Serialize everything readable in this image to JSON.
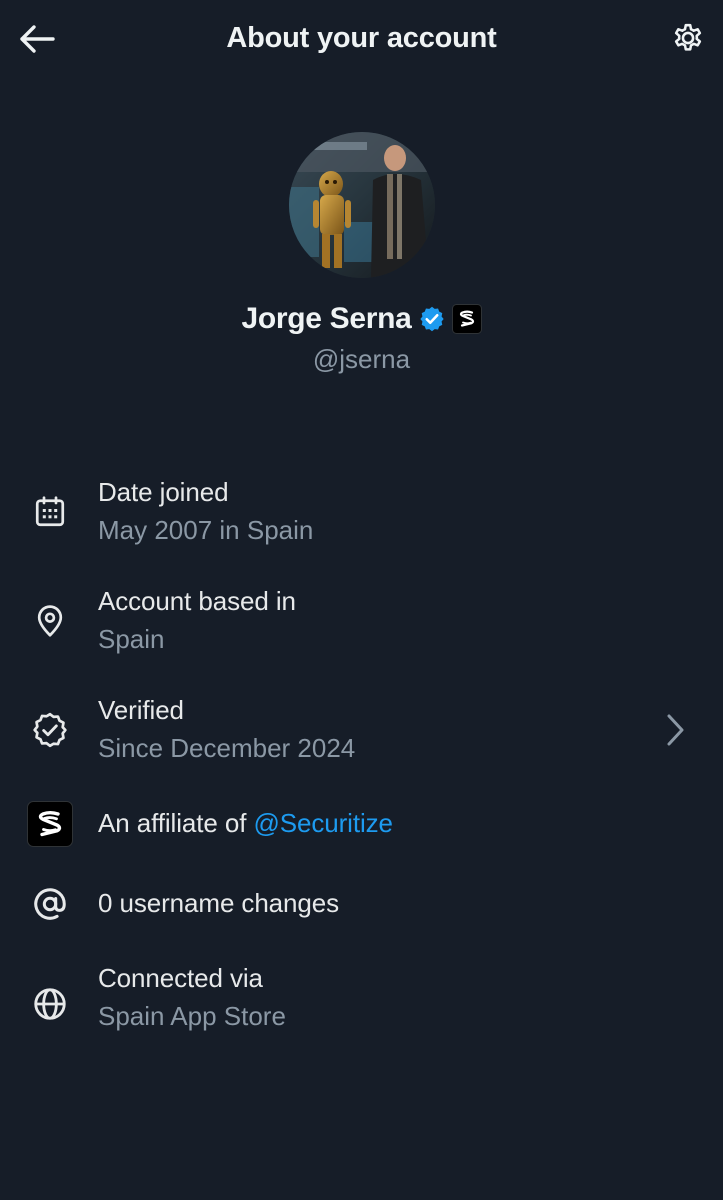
{
  "header": {
    "title": "About your account",
    "back_icon": "arrow-left-icon",
    "settings_icon": "gear-icon"
  },
  "profile": {
    "display_name": "Jorge Serna",
    "handle": "@jserna",
    "verified_color": "#1d9bf0"
  },
  "details": {
    "date_joined": {
      "icon": "calendar-icon",
      "title": "Date joined",
      "value": "May 2007 in Spain"
    },
    "based_in": {
      "icon": "location-pin-icon",
      "title": "Account based in",
      "value": "Spain"
    },
    "verified": {
      "icon": "verified-check-icon",
      "title": "Verified",
      "value": "Since December 2024",
      "chevron_icon": "chevron-right-icon"
    },
    "affiliate": {
      "icon": "securitize-logo-icon",
      "prefix": "An affiliate of ",
      "link": "@Securitize"
    },
    "username_changes": {
      "icon": "at-sign-icon",
      "title": "0 username changes"
    },
    "connected": {
      "icon": "globe-icon",
      "title": "Connected via",
      "value": "Spain App Store"
    }
  },
  "colors": {
    "background": "#161d28",
    "text_primary": "#e7e9ea",
    "text_secondary": "#8b98a5",
    "link": "#1d9bf0"
  }
}
